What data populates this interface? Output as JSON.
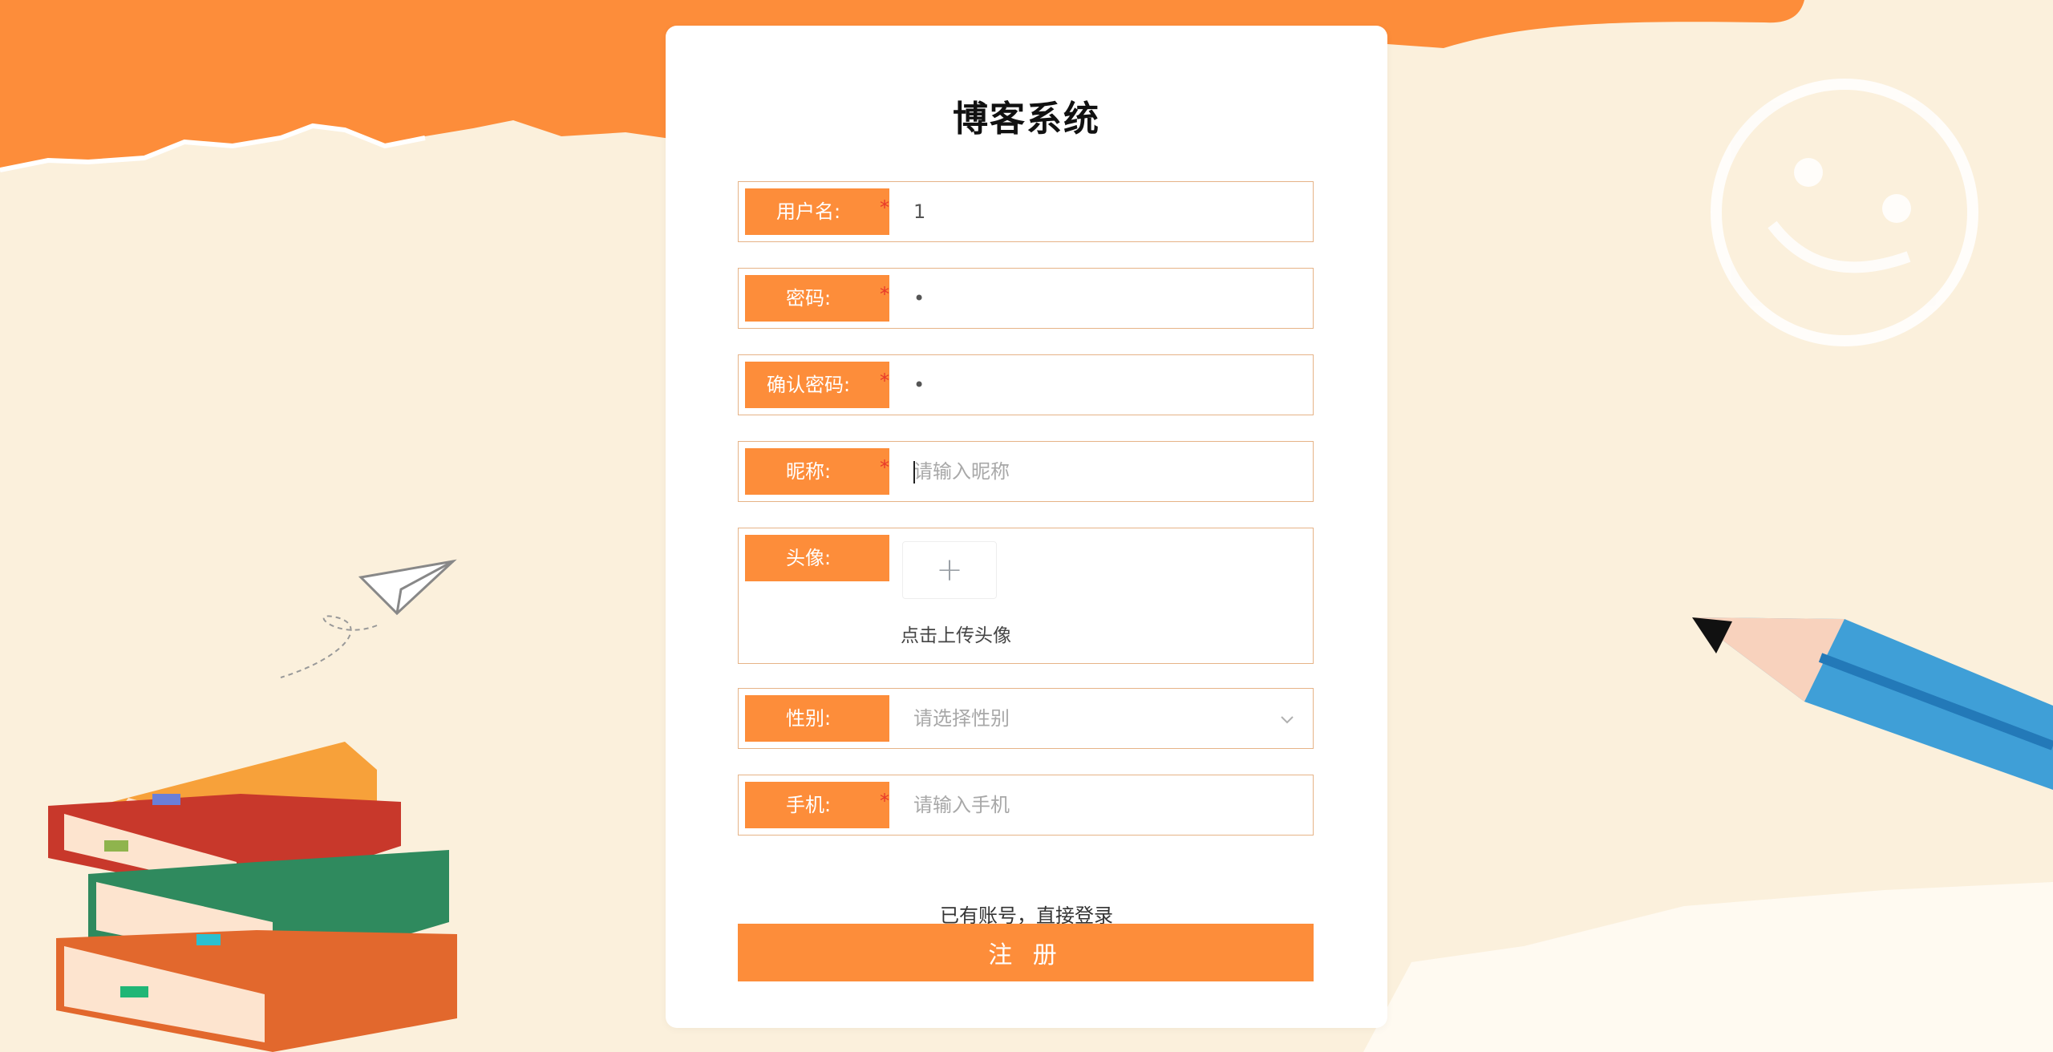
{
  "page": {
    "title": "博客系统"
  },
  "form": {
    "username": {
      "label": "用户名:",
      "value": "1",
      "placeholder": ""
    },
    "password": {
      "label": "密码:",
      "value": "•",
      "placeholder": ""
    },
    "confirm_password": {
      "label": "确认密码:",
      "value": "•",
      "placeholder": ""
    },
    "nickname": {
      "label": "昵称:",
      "value": "",
      "placeholder": "请输入昵称"
    },
    "avatar": {
      "label": "头像:",
      "hint": "点击上传头像"
    },
    "gender": {
      "label": "性别:",
      "placeholder": "请选择性别"
    },
    "phone": {
      "label": "手机:",
      "value": "",
      "placeholder": "请输入手机"
    },
    "required_mark": "*"
  },
  "login_link": "已有账号，直接登录",
  "submit_label": "注 册",
  "colors": {
    "accent": "#fd8d3a",
    "background": "#fbf0dc",
    "required": "#e83a2a"
  },
  "icons": {
    "upload": "plus-icon",
    "dropdown": "chevron-down-icon"
  }
}
